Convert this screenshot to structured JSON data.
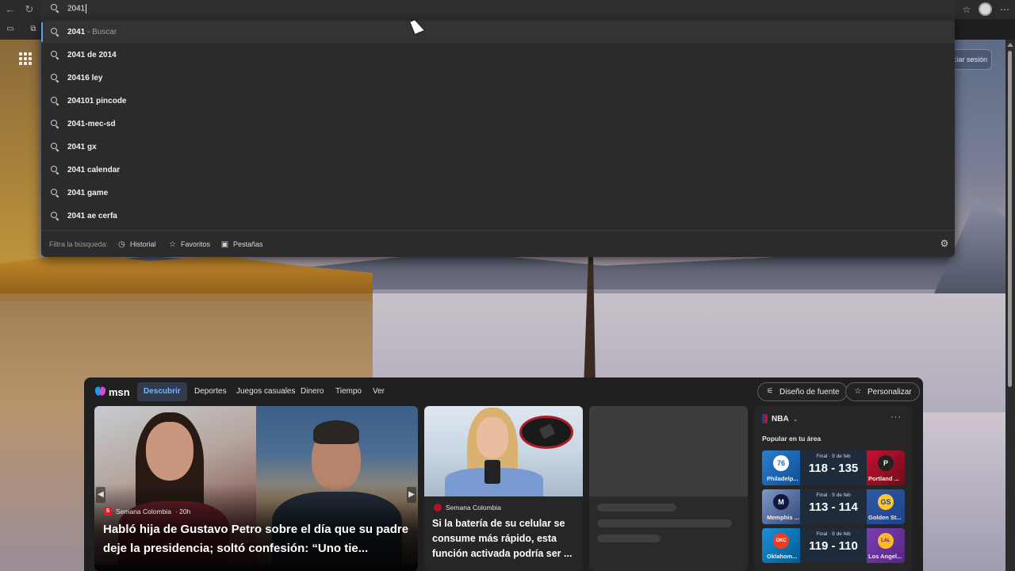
{
  "browser": {
    "address_text": "2041",
    "signin_label": "iciar sesión"
  },
  "suggestions": [
    {
      "text": "2041",
      "hint": " - Buscar"
    },
    {
      "text": "2041 de 2014"
    },
    {
      "text": "20416 ley"
    },
    {
      "text": "204101 pincode"
    },
    {
      "text": "2041-mec-sd"
    },
    {
      "text": "2041 gx"
    },
    {
      "text": "2041 calendar"
    },
    {
      "text": "2041 game"
    },
    {
      "text": "2041 ae cerfa"
    }
  ],
  "filter": {
    "label": "Filtra la búsqueda:",
    "chips": [
      "Historial",
      "Favoritos",
      "Pestañas"
    ]
  },
  "msn": {
    "logo": "msn",
    "tabs": [
      "Descubrir",
      "Deportes",
      "Juegos casuales",
      "Dinero",
      "Tiempo",
      "Ver"
    ],
    "design_btn": "Diseño de fuente",
    "customize_btn": "Personalizar",
    "hero": {
      "source": "Semana Colombia",
      "age": "· 20h",
      "source_logo": "S",
      "headline": "Habló hija de Gustavo Petro sobre el día que su padre deje la presidencia; soltó confesión: “Uno tie..."
    },
    "card2": {
      "source": "Semana Colombia",
      "headline": "Si la batería de su celular se consume más rápido, esta función activada podría ser ..."
    },
    "nba": {
      "title": "NBA",
      "popular": "Popular en tu área",
      "games": [
        {
          "status": "Final · 9 de feb",
          "score": "118 - 135",
          "left_team": "Philadelp...",
          "right_team": "Portland ...",
          "left_logo": "76",
          "right_logo": "P",
          "left_color": "#1d6fbf",
          "right_color": "#c8102e"
        },
        {
          "status": "Final · 9 de feb",
          "score": "113 - 114",
          "left_team": "Memphis ...",
          "right_team": "Golden St...",
          "left_logo": "M",
          "right_logo": "GS",
          "left_color": "#5d76a9",
          "right_color": "#1d428a"
        },
        {
          "status": "Final · 9 de feb",
          "score": "119 - 110",
          "left_team": "Oklahom...",
          "right_team": "Los Angel...",
          "left_logo": "OKC",
          "right_logo": "LAL",
          "left_color": "#007ac1",
          "right_color": "#552583"
        }
      ]
    }
  }
}
